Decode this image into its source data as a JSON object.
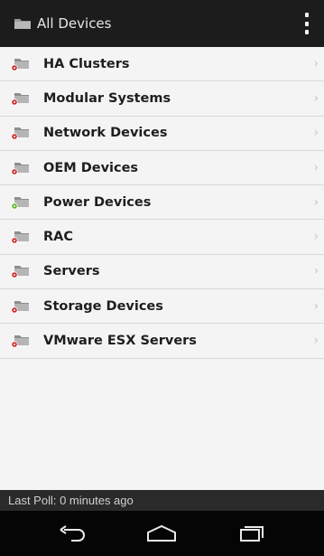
{
  "header": {
    "title": "All Devices",
    "icon": "folder-icon",
    "menu_icon": "overflow-menu-icon"
  },
  "device_groups": [
    {
      "label": "HA Clusters",
      "status": "critical",
      "status_color": "#d12a2a"
    },
    {
      "label": "Modular Systems",
      "status": "critical",
      "status_color": "#d12a2a"
    },
    {
      "label": "Network Devices",
      "status": "critical",
      "status_color": "#d12a2a"
    },
    {
      "label": "OEM Devices",
      "status": "critical",
      "status_color": "#d12a2a"
    },
    {
      "label": "Power Devices",
      "status": "ok",
      "status_color": "#5cb82e"
    },
    {
      "label": "RAC",
      "status": "critical",
      "status_color": "#d12a2a"
    },
    {
      "label": "Servers",
      "status": "critical",
      "status_color": "#d12a2a"
    },
    {
      "label": "Storage Devices",
      "status": "critical",
      "status_color": "#d12a2a"
    },
    {
      "label": "VMware ESX Servers",
      "status": "critical",
      "status_color": "#d12a2a"
    }
  ],
  "footer": {
    "last_poll": "Last Poll: 0 minutes ago"
  },
  "system_nav": {
    "back_icon": "back-icon",
    "home_icon": "home-icon",
    "recents_icon": "recent-apps-icon"
  },
  "colors": {
    "app_bar": "#1c1c1c",
    "list_background": "#f4f4f4",
    "status_critical": "#d12a2a",
    "status_ok": "#5cb82e"
  }
}
